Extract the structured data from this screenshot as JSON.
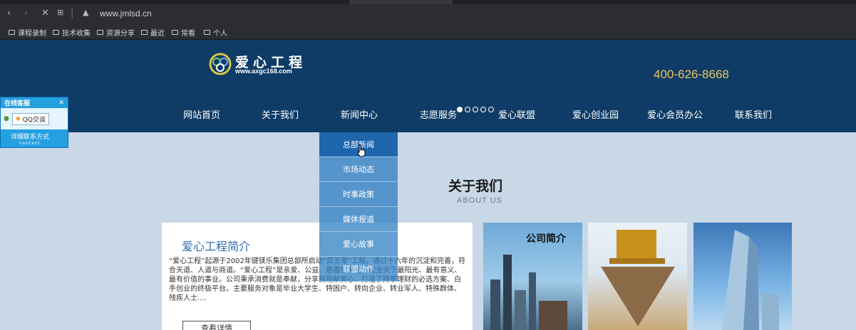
{
  "browser": {
    "url": "www.jmlsd.cn",
    "bookmarks": [
      "课程录制",
      "技术收集",
      "资源分享",
      "最近",
      "常看",
      "个人"
    ]
  },
  "header": {
    "logo_title": "爱心工程",
    "logo_url": "www.axgc168.com",
    "phone": "400-626-8668"
  },
  "nav": {
    "items": [
      "网站首页",
      "关于我们",
      "新闻中心",
      "志愿服务",
      "爱心联盟",
      "爱心创业园",
      "爱心会员办公",
      "联系我们"
    ]
  },
  "dropdown": {
    "items": [
      "总部新闻",
      "市场动态",
      "时事政策",
      "媒体报道",
      "爱心故事",
      "联盟动作"
    ]
  },
  "about": {
    "title": "关于我们",
    "subtitle": "ABOUT US",
    "intro_title": "爱心工程简介",
    "intro_text": "“爱心工程”起源于2002年键镁乐集团总部所启动“双五零”工程，通过十六年的沉淀和完善，符合天道、人道与商道。“爱心工程”是亲爱、公益、慈善的事业，是全天下最阳光、最有意义、最有价值的事业。公司秉承消费就是奉献，分享就是献爱心，打造了持家理财的必选方案、白手创业的终极平台。主要服务对象是毕业大学生、特困户、转向企业、转业军人、特殊群体、残疾人士....",
    "more_label": "查看详情",
    "image_label": "公司简介"
  },
  "service": {
    "title": "在线客服",
    "qq_label": "QQ交谈",
    "contact_label": "详细联系方式",
    "contact_sub": "contact"
  },
  "colors": {
    "header_bg": "#0f3c66",
    "phone": "#f0c564",
    "dropdown_active": "#1f66ad",
    "page_bg": "#c8d8e6",
    "intro_title": "#2c6db0"
  }
}
